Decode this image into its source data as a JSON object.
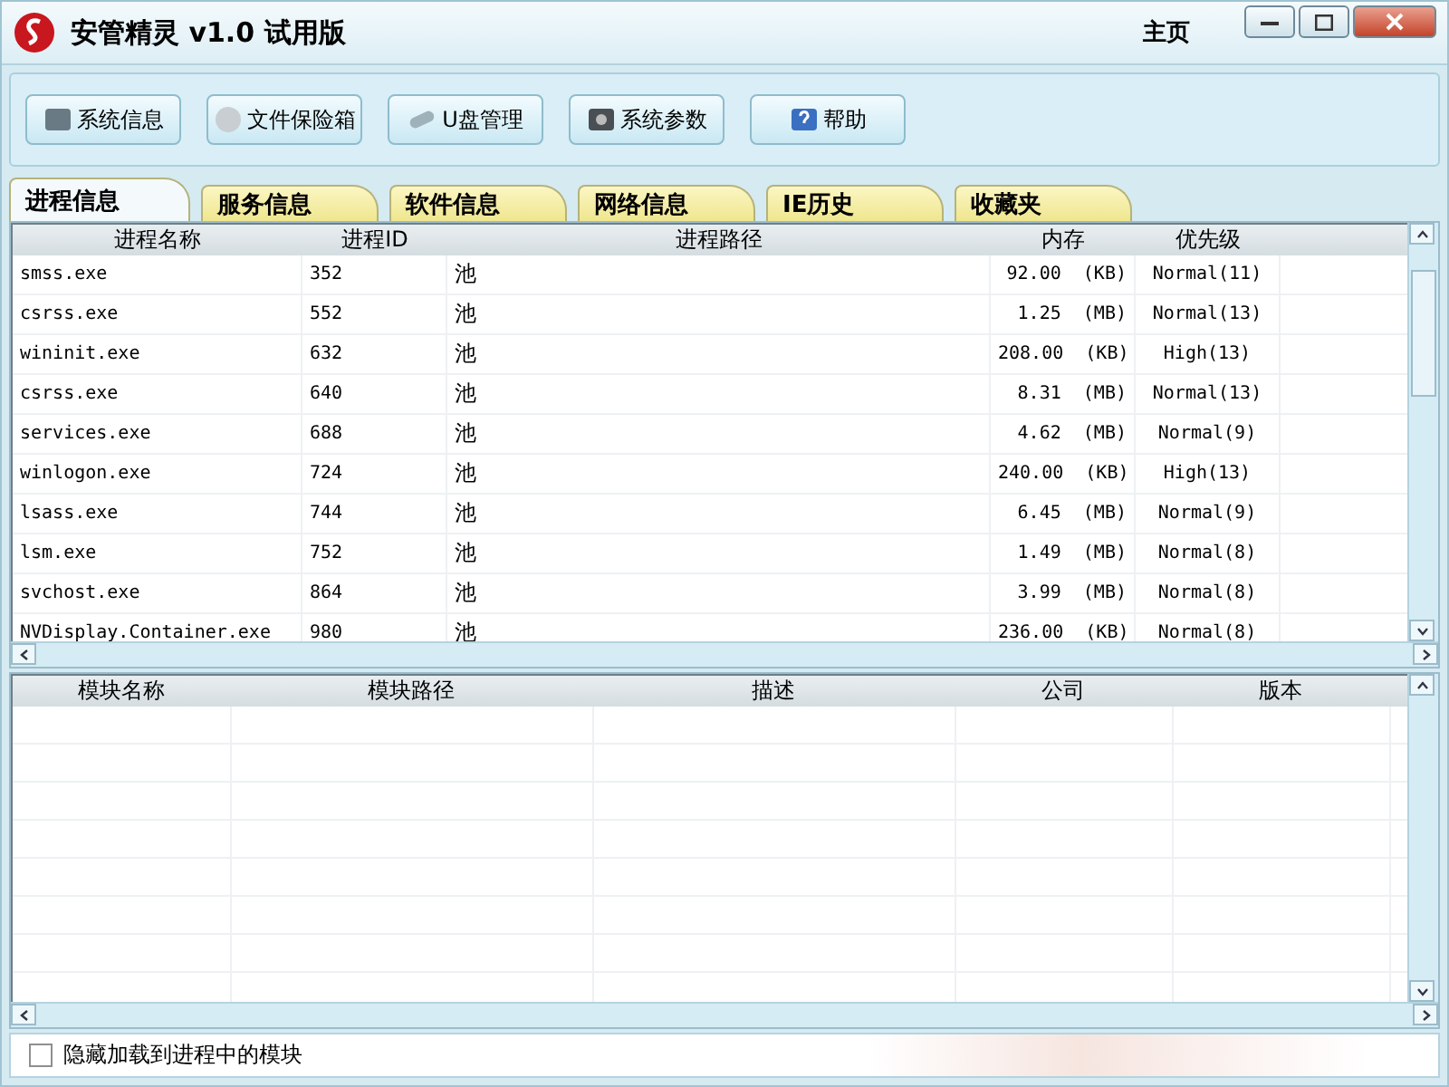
{
  "window": {
    "title": "安管精灵 v1.0 试用版",
    "home_link": "主页"
  },
  "toolbar": [
    "系统信息",
    "文件保险箱",
    "U盘管理",
    "系统参数",
    "帮助"
  ],
  "tabs": [
    {
      "label": "进程信息",
      "selected": true
    },
    {
      "label": "服务信息",
      "selected": false
    },
    {
      "label": "软件信息",
      "selected": false
    },
    {
      "label": "网络信息",
      "selected": false
    },
    {
      "label": "IE历史",
      "selected": false
    },
    {
      "label": "收藏夹",
      "selected": false
    }
  ],
  "process_table": {
    "columns": [
      "进程名称",
      "进程ID",
      "进程路径",
      "内存",
      "优先级"
    ],
    "rows": [
      [
        "smss.exe",
        "352",
        "池",
        "92.00  (KB)",
        "Normal(11)"
      ],
      [
        "csrss.exe",
        "552",
        "池",
        "1.25  (MB)",
        "Normal(13)"
      ],
      [
        "wininit.exe",
        "632",
        "池",
        "208.00  (KB)",
        "High(13)"
      ],
      [
        "csrss.exe",
        "640",
        "池",
        "8.31  (MB)",
        "Normal(13)"
      ],
      [
        "services.exe",
        "688",
        "池",
        "4.62  (MB)",
        "Normal(9)"
      ],
      [
        "winlogon.exe",
        "724",
        "池",
        "240.00  (KB)",
        "High(13)"
      ],
      [
        "lsass.exe",
        "744",
        "池",
        "6.45  (MB)",
        "Normal(9)"
      ],
      [
        "lsm.exe",
        "752",
        "池",
        "1.49  (MB)",
        "Normal(8)"
      ],
      [
        "svchost.exe",
        "864",
        "池",
        "3.99  (MB)",
        "Normal(8)"
      ],
      [
        "NVDisplay.Container.exe",
        "980",
        "池",
        "236.00  (KB)",
        "Normal(8)"
      ]
    ]
  },
  "module_table": {
    "columns": [
      "模块名称",
      "模块路径",
      "描述",
      "公司",
      "版本"
    ]
  },
  "hide_modules": {
    "label": "隐藏加载到进程中的模块",
    "checked": false
  }
}
